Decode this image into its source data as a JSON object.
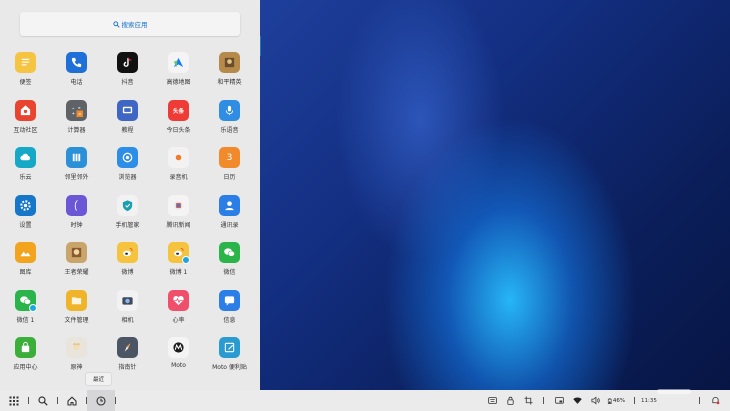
{
  "search": {
    "label": "搜索应用"
  },
  "apps": [
    {
      "label": "便签",
      "icon": "notes-icon",
      "color": "#f6c443"
    },
    {
      "label": "电话",
      "icon": "phone-icon",
      "color": "#1f6fd8"
    },
    {
      "label": "抖音",
      "icon": "tiktok-icon",
      "color": "#111111"
    },
    {
      "label": "高德地图",
      "icon": "amap-icon",
      "color": "#f4f4f4"
    },
    {
      "label": "和平精英",
      "icon": "game-peace-icon",
      "color": "#b58a4a"
    },
    {
      "label": "互动社区",
      "icon": "community-icon",
      "color": "#e8442f"
    },
    {
      "label": "计算器",
      "icon": "calculator-icon",
      "color": "#5f6368"
    },
    {
      "label": "教程",
      "icon": "tutorial-icon",
      "color": "#3f66c4"
    },
    {
      "label": "今日头条",
      "icon": "toutiao-icon",
      "color": "#ee3b36"
    },
    {
      "label": "乐语音",
      "icon": "voice-icon",
      "color": "#2f8de4"
    },
    {
      "label": "乐云",
      "icon": "cloud-icon",
      "color": "#16a9c7"
    },
    {
      "label": "邻里邻外",
      "icon": "neighbor-icon",
      "color": "#2a91d8"
    },
    {
      "label": "浏览器",
      "icon": "browser-icon",
      "color": "#2d8ee8"
    },
    {
      "label": "录音机",
      "icon": "recorder-icon",
      "color": "#f2f2f2"
    },
    {
      "label": "日历",
      "icon": "calendar-icon",
      "color": "#f08a2b",
      "text": "3"
    },
    {
      "label": "设置",
      "icon": "settings-icon",
      "color": "#1677c9"
    },
    {
      "label": "时钟",
      "icon": "clock-icon",
      "color": "#6b57d6"
    },
    {
      "label": "手机管家",
      "icon": "phone-manager-icon",
      "color": "#f2f2f2"
    },
    {
      "label": "腾讯新闻",
      "icon": "tencent-news-icon",
      "color": "#f4f4f4"
    },
    {
      "label": "通讯录",
      "icon": "contacts-icon",
      "color": "#2a7ee6"
    },
    {
      "label": "图库",
      "icon": "gallery-icon",
      "color": "#f2a41f"
    },
    {
      "label": "王者荣耀",
      "icon": "honor-of-kings-icon",
      "color": "#c9a56b"
    },
    {
      "label": "微博",
      "icon": "weibo-icon",
      "color": "#f6c33e"
    },
    {
      "label": "微博 1",
      "icon": "weibo-clone-icon",
      "color": "#f6c33e"
    },
    {
      "label": "微信",
      "icon": "wechat-icon",
      "color": "#2bb44a"
    },
    {
      "label": "微信 1",
      "icon": "wechat-clone-icon",
      "color": "#2bb44a"
    },
    {
      "label": "文件管理",
      "icon": "file-manager-icon",
      "color": "#f0b42a"
    },
    {
      "label": "相机",
      "icon": "camera-icon",
      "color": "#f2f2f2"
    },
    {
      "label": "心率",
      "icon": "heart-rate-icon",
      "color": "#ef4f6a"
    },
    {
      "label": "信息",
      "icon": "messages-icon",
      "color": "#2a7ee6"
    },
    {
      "label": "应用中心",
      "icon": "app-center-icon",
      "color": "#3cae3a"
    },
    {
      "label": "原神",
      "icon": "genshin-icon",
      "color": "#e9e4dc"
    },
    {
      "label": "指南针",
      "icon": "compass-icon",
      "color": "#4b5563"
    },
    {
      "label": "Moto",
      "icon": "moto-icon",
      "color": "#f4f4f4"
    },
    {
      "label": "Moto 便利贴",
      "icon": "moto-note-icon",
      "color": "#2a9bd0"
    }
  ],
  "tooltip": "最近",
  "taskbar": {
    "battery": "46%",
    "clock": "11:35"
  }
}
